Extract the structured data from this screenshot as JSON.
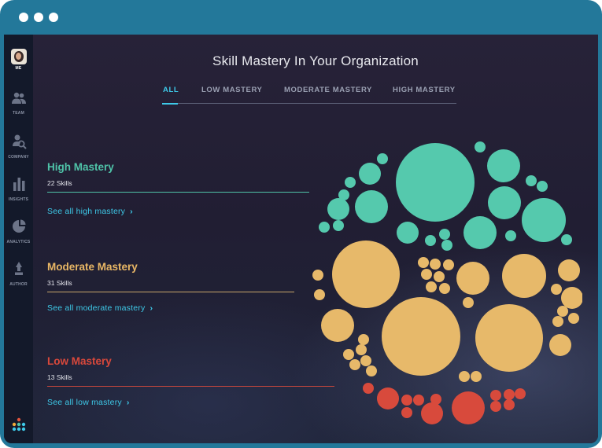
{
  "window": {
    "controls": [
      "close",
      "minimize",
      "maximize"
    ]
  },
  "sidebar": {
    "items": [
      {
        "label": "ME",
        "icon": "avatar",
        "active": true
      },
      {
        "label": "TEAM",
        "icon": "team-icon"
      },
      {
        "label": "COMPANY",
        "icon": "company-icon"
      },
      {
        "label": "INSIGHTS",
        "icon": "insights-icon"
      },
      {
        "label": "ANALYTICS",
        "icon": "analytics-icon"
      },
      {
        "label": "AUTHOR",
        "icon": "author-icon"
      }
    ]
  },
  "main": {
    "title": "Skill Mastery In Your Organization",
    "tabs": [
      {
        "label": "ALL",
        "active": true
      },
      {
        "label": "LOW MASTERY"
      },
      {
        "label": "MODERATE MASTERY"
      },
      {
        "label": "HIGH MASTERY"
      }
    ],
    "categories": [
      {
        "name": "High Mastery",
        "count": "22 Skills",
        "link": "See all high mastery",
        "color": "#4fc3a8"
      },
      {
        "name": "Moderate Mastery",
        "count": "31 Skills",
        "link": "See all moderate mastery",
        "color": "#e9b765"
      },
      {
        "name": "Low Mastery",
        "count": "13 Skills",
        "link": "See all low mastery",
        "color": "#d9483b"
      }
    ]
  },
  "colors": {
    "accent": "#3ec9e8",
    "high": "#55c9ad",
    "moderate": "#e7b96a",
    "low": "#d84a3c"
  }
}
